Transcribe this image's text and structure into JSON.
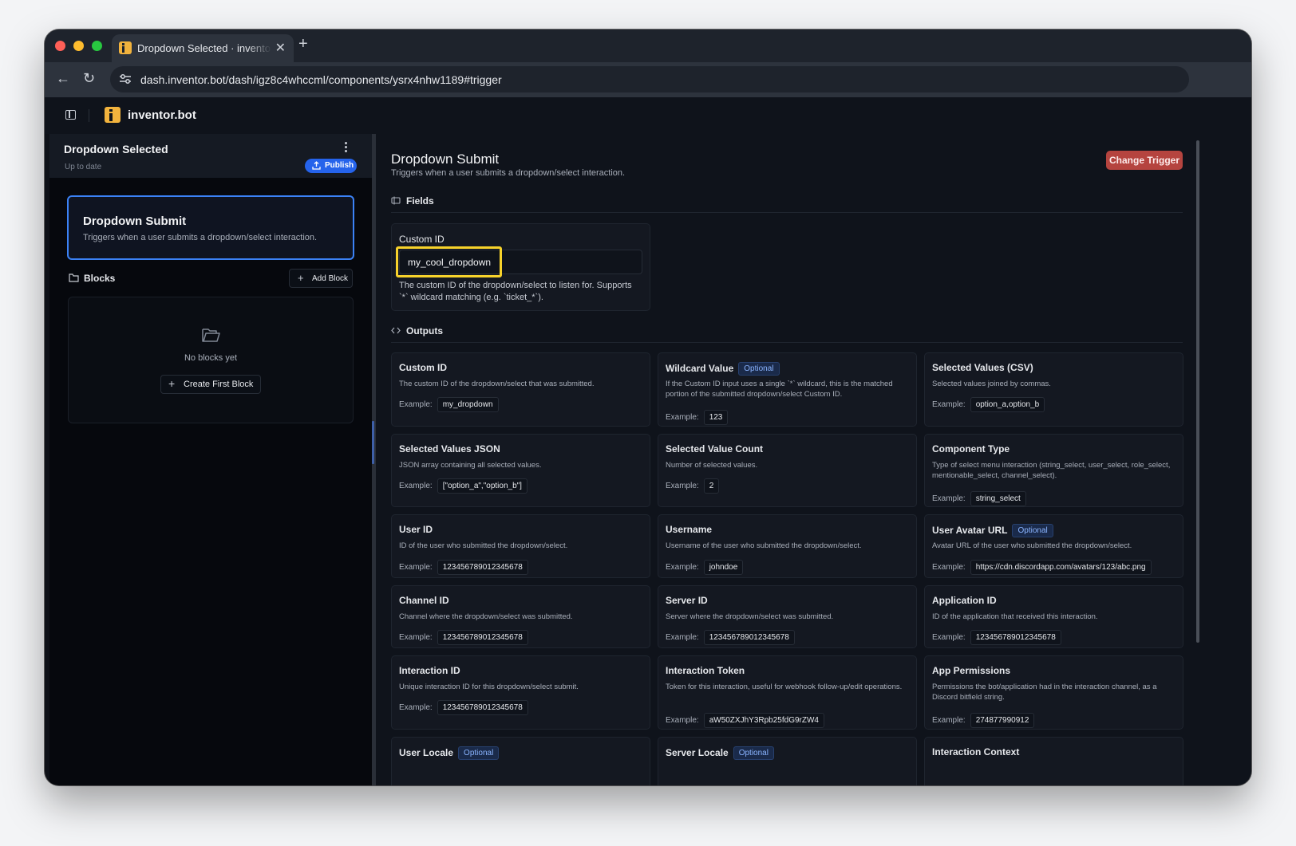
{
  "browser": {
    "tab_title": "Dropdown Selected · inventor.bot",
    "url": "dash.inventor.bot/dash/igz8c4whccml/components/ysrx4nhw1189#trigger"
  },
  "app": {
    "name": "inventor.bot"
  },
  "sidebar": {
    "title": "Dropdown Selected",
    "status": "Up to date",
    "publish_label": "Publish",
    "trigger_card": {
      "title": "Dropdown Submit",
      "description": "Triggers when a user submits a dropdown/select interaction."
    },
    "blocks_label": "Blocks",
    "add_block_label": "Add Block",
    "empty_text": "No blocks yet",
    "create_first_label": "Create First Block"
  },
  "main": {
    "title": "Dropdown Submit",
    "description": "Triggers when a user submits a dropdown/select interaction.",
    "change_trigger_label": "Change Trigger",
    "fields_label": "Fields",
    "outputs_label": "Outputs",
    "custom_id_field": {
      "label": "Custom ID",
      "value": "my_cool_dropdown",
      "help_1": "The custom ID of the dropdown/select to listen for. Supports",
      "help_2": "`*` wildcard matching (e.g. `ticket_*`)."
    },
    "example_label": "Example:",
    "optional_label": "Optional",
    "outputs": [
      {
        "title": "Custom ID",
        "optional": false,
        "desc": "The custom ID of the dropdown/select that was submitted.",
        "example": "my_dropdown"
      },
      {
        "title": "Wildcard Value",
        "optional": true,
        "desc": "If the Custom ID input uses a single `*` wildcard, this is the matched portion of the submitted dropdown/select Custom ID.",
        "example": "123"
      },
      {
        "title": "Selected Values (CSV)",
        "optional": false,
        "desc": "Selected values joined by commas.",
        "example": "option_a,option_b"
      },
      {
        "title": "Selected Values JSON",
        "optional": false,
        "desc": "JSON array containing all selected values.",
        "example": "[\"option_a\",\"option_b\"]"
      },
      {
        "title": "Selected Value Count",
        "optional": false,
        "desc": "Number of selected values.",
        "example": "2"
      },
      {
        "title": "Component Type",
        "optional": false,
        "desc": "Type of select menu interaction (string_select, user_select, role_select, mentionable_select, channel_select).",
        "example": "string_select"
      },
      {
        "title": "User ID",
        "optional": false,
        "desc": "ID of the user who submitted the dropdown/select.",
        "example": "123456789012345678"
      },
      {
        "title": "Username",
        "optional": false,
        "desc": "Username of the user who submitted the dropdown/select.",
        "example": "johndoe"
      },
      {
        "title": "User Avatar URL",
        "optional": true,
        "desc": "Avatar URL of the user who submitted the dropdown/select.",
        "example": "https://cdn.discordapp.com/avatars/123/abc.png"
      },
      {
        "title": "Channel ID",
        "optional": false,
        "desc": "Channel where the dropdown/select was submitted.",
        "example": "123456789012345678"
      },
      {
        "title": "Server ID",
        "optional": false,
        "desc": "Server where the dropdown/select was submitted.",
        "example": "123456789012345678"
      },
      {
        "title": "Application ID",
        "optional": false,
        "desc": "ID of the application that received this interaction.",
        "example": "123456789012345678"
      },
      {
        "title": "Interaction ID",
        "optional": false,
        "desc": "Unique interaction ID for this dropdown/select submit.",
        "example": "123456789012345678"
      },
      {
        "title": "Interaction Token",
        "optional": false,
        "desc": "Token for this interaction, useful for webhook follow-up/edit operations.",
        "example": "aW50ZXJhY3Rpb25fdG9rZW4"
      },
      {
        "title": "App Permissions",
        "optional": false,
        "desc": "Permissions the bot/application had in the interaction channel, as a Discord bitfield string.",
        "example": "274877990912"
      },
      {
        "title": "User Locale",
        "optional": true,
        "desc": "",
        "example": ""
      },
      {
        "title": "Server Locale",
        "optional": true,
        "desc": "",
        "example": ""
      },
      {
        "title": "Interaction Context",
        "optional": false,
        "desc": "",
        "example": ""
      }
    ]
  }
}
